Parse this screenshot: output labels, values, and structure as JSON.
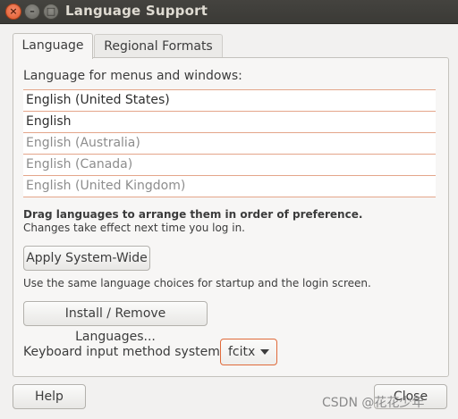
{
  "window": {
    "title": "Language Support",
    "controls": {
      "close": "×",
      "minimize": "–",
      "maximize": "□"
    }
  },
  "tabs": [
    {
      "label": "Language",
      "active": true
    },
    {
      "label": "Regional Formats",
      "active": false
    }
  ],
  "language": {
    "section_label": "Language for menus and windows:",
    "items": [
      {
        "label": "English (United States)",
        "enabled": true
      },
      {
        "label": "English",
        "enabled": true
      },
      {
        "label": "English (Australia)",
        "enabled": false
      },
      {
        "label": "English (Canada)",
        "enabled": false
      },
      {
        "label": "English (United Kingdom)",
        "enabled": false
      }
    ],
    "hint_bold": "Drag languages to arrange them in order of preference.",
    "hint": "Changes take effect next time you log in.",
    "apply_button": "Apply System-Wide",
    "apply_note": "Use the same language choices for startup and the login screen.",
    "install_button": "Install / Remove Languages...",
    "keyboard_label": "Keyboard input method system:",
    "keyboard_value": "fcitx"
  },
  "footer": {
    "help_button": "Help",
    "close_button": "Close"
  },
  "watermark": "CSDN @花花少年",
  "colors": {
    "accent": "#e06a3a",
    "titlebar": "#3b3a36"
  }
}
